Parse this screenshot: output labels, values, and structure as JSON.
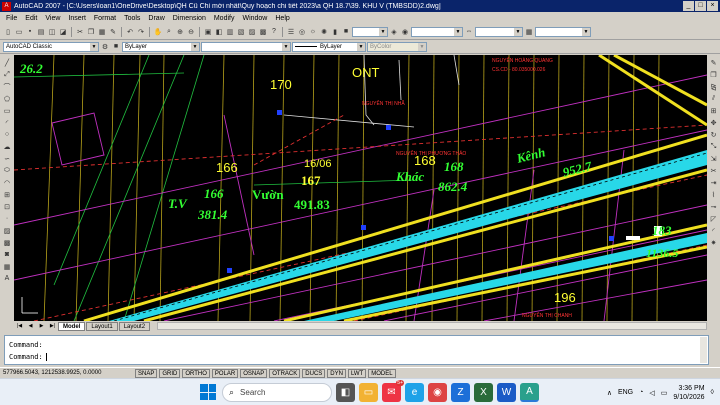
{
  "window": {
    "title": "AutoCAD 2007 - [C:\\Users\\loan1\\OneDrive\\Desktop\\QH Cũ Chỉ mới nhất\\Quy hoạch chi tiết 2023\\a QH 18.7\\39. KHU V (TMBSDD)2.dwg]",
    "logo": "A",
    "min_label": "_",
    "max_label": "□",
    "close_label": "×"
  },
  "menu": [
    "File",
    "Edit",
    "View",
    "Insert",
    "Format",
    "Tools",
    "Draw",
    "Dimension",
    "Modify",
    "Window",
    "Help"
  ],
  "toolbar2": {
    "workspace": "AutoCAD Classic",
    "layer_color": "ByLayer",
    "linetype": "ByLayer",
    "plotstyle": "ByColor"
  },
  "drawing": {
    "labels": [
      {
        "text": "26.2",
        "color": "#33ff33"
      },
      {
        "text": "ONT",
        "color": "#ffff33"
      },
      {
        "text": "170",
        "color": "#ffff33"
      },
      {
        "text": "166",
        "color": "#ffff33"
      },
      {
        "text": "168",
        "color": "#ffff33"
      },
      {
        "text": "16/06",
        "color": "#ffff33"
      },
      {
        "text": "167",
        "color": "#ffff33"
      },
      {
        "text": "Vườn",
        "color": "#33ff33"
      },
      {
        "text": "491.83",
        "color": "#33ff33"
      },
      {
        "text": "T.V",
        "color": "#33ff33"
      },
      {
        "text": "166",
        "color": "#33ff33"
      },
      {
        "text": "381.4",
        "color": "#33ff33"
      },
      {
        "text": "Khác",
        "color": "#33ff33"
      },
      {
        "text": "168",
        "color": "#33ff33"
      },
      {
        "text": "862.4",
        "color": "#33ff33"
      },
      {
        "text": "Kênh",
        "color": "#33ff33"
      },
      {
        "text": "952.7",
        "color": "#33ff33"
      },
      {
        "text": "196",
        "color": "#ffff33"
      },
      {
        "text": "183",
        "color": "#33ff33"
      },
      {
        "text": "1136.5",
        "color": "#33ff33"
      },
      {
        "text": "NGUYỄN THỊ NHÃ",
        "color": "#ff3333"
      },
      {
        "text": "NGUYỄN THỊ PHƯƠNG THẢO",
        "color": "#ff3333"
      },
      {
        "text": "NGUYỄN THỊ CHANH",
        "color": "#ff3333"
      },
      {
        "text": "NGUYỄN HOÀNG QUANG",
        "color": "#ff3333"
      },
      {
        "text": "CS.CD - 80.035000.026",
        "color": "#ff3333"
      }
    ]
  },
  "tabs": {
    "nav": [
      "|◀",
      "◀",
      "▶",
      "▶|"
    ],
    "items": [
      "Model",
      "Layout1",
      "Layout2"
    ]
  },
  "command": {
    "line1": "Command:",
    "line2": "Command:"
  },
  "status": {
    "coords": "577966.5043, 1212538.9925, 0.0000",
    "buttons": [
      "SNAP",
      "GRID",
      "ORTHO",
      "POLAR",
      "OSNAP",
      "OTRACK",
      "DUCS",
      "DYN",
      "LWT",
      "MODEL"
    ]
  },
  "taskbar": {
    "search_placeholder": "Search",
    "badge": "5+",
    "lang": "ENG",
    "time": "3:36 PM",
    "date": "9/10/2026"
  }
}
